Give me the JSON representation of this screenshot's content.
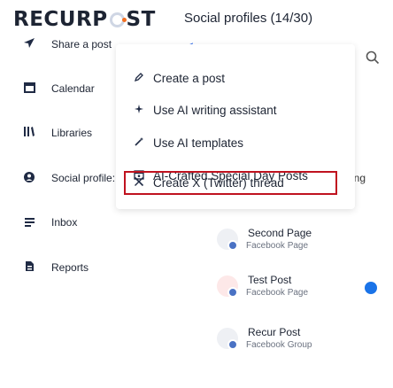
{
  "header": {
    "logo_left": "RECURP",
    "logo_right": "ST",
    "title": "Social profiles (14/30)"
  },
  "sidebar": {
    "items": [
      {
        "label": "Share a post",
        "icon": "send-icon"
      },
      {
        "label": "Calendar",
        "icon": "calendar-icon"
      },
      {
        "label": "Libraries",
        "icon": "libraries-icon"
      },
      {
        "label": "Social profile:",
        "icon": "globe-icon"
      },
      {
        "label": "Inbox",
        "icon": "inbox-icon"
      },
      {
        "label": "Reports",
        "icon": "reports-icon"
      }
    ]
  },
  "collapse_glyph": "<",
  "dropdown": {
    "items": [
      {
        "label": "Create a post",
        "icon": "pencil-icon"
      },
      {
        "label": "Use AI writing assistant",
        "icon": "sparkle-icon"
      },
      {
        "label": "Use AI templates",
        "icon": "wand-icon"
      },
      {
        "label": "AI-Crafted Special Day Posts",
        "icon": "calendar-star-icon"
      },
      {
        "label": "Create X (Twitter) thread",
        "icon": "x-logo-icon"
      }
    ]
  },
  "truncated_text": "ing",
  "pages": [
    {
      "name": "Second Page",
      "type": "Facebook Page"
    },
    {
      "name": "Test Post",
      "type": "Facebook Page"
    },
    {
      "name": "Recur Post",
      "type": "Facebook Group"
    }
  ]
}
